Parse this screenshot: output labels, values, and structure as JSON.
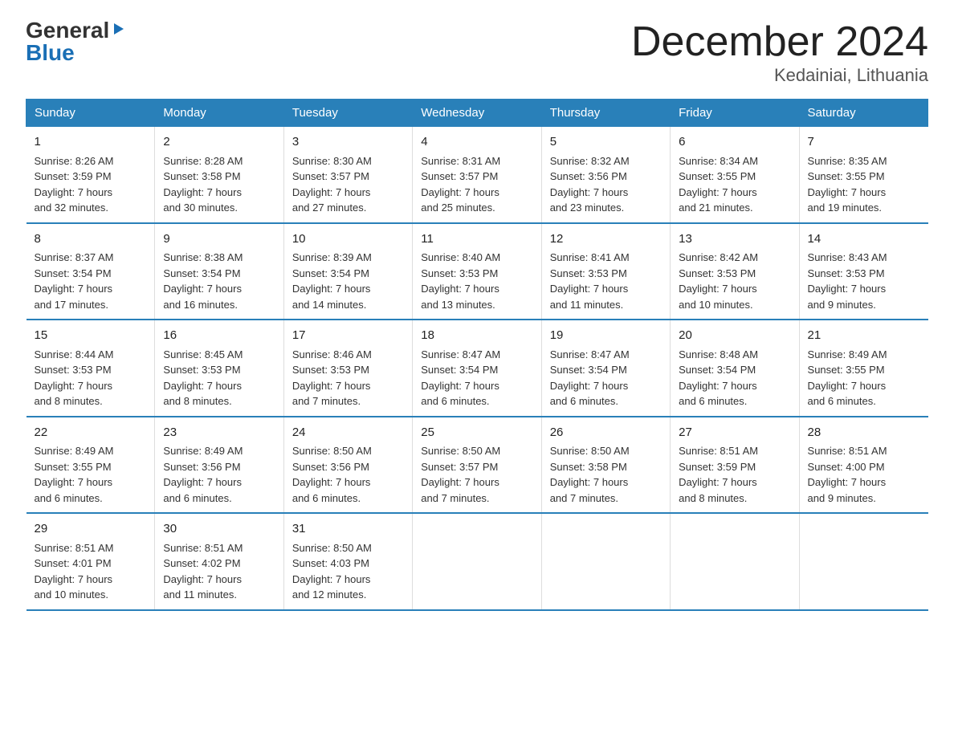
{
  "logo": {
    "general": "General",
    "blue": "Blue",
    "triangle": "▶"
  },
  "title": "December 2024",
  "subtitle": "Kedainiai, Lithuania",
  "weekdays": [
    "Sunday",
    "Monday",
    "Tuesday",
    "Wednesday",
    "Thursday",
    "Friday",
    "Saturday"
  ],
  "weeks": [
    [
      {
        "day": "1",
        "sunrise": "Sunrise: 8:26 AM",
        "sunset": "Sunset: 3:59 PM",
        "daylight": "Daylight: 7 hours",
        "minutes": "and 32 minutes."
      },
      {
        "day": "2",
        "sunrise": "Sunrise: 8:28 AM",
        "sunset": "Sunset: 3:58 PM",
        "daylight": "Daylight: 7 hours",
        "minutes": "and 30 minutes."
      },
      {
        "day": "3",
        "sunrise": "Sunrise: 8:30 AM",
        "sunset": "Sunset: 3:57 PM",
        "daylight": "Daylight: 7 hours",
        "minutes": "and 27 minutes."
      },
      {
        "day": "4",
        "sunrise": "Sunrise: 8:31 AM",
        "sunset": "Sunset: 3:57 PM",
        "daylight": "Daylight: 7 hours",
        "minutes": "and 25 minutes."
      },
      {
        "day": "5",
        "sunrise": "Sunrise: 8:32 AM",
        "sunset": "Sunset: 3:56 PM",
        "daylight": "Daylight: 7 hours",
        "minutes": "and 23 minutes."
      },
      {
        "day": "6",
        "sunrise": "Sunrise: 8:34 AM",
        "sunset": "Sunset: 3:55 PM",
        "daylight": "Daylight: 7 hours",
        "minutes": "and 21 minutes."
      },
      {
        "day": "7",
        "sunrise": "Sunrise: 8:35 AM",
        "sunset": "Sunset: 3:55 PM",
        "daylight": "Daylight: 7 hours",
        "minutes": "and 19 minutes."
      }
    ],
    [
      {
        "day": "8",
        "sunrise": "Sunrise: 8:37 AM",
        "sunset": "Sunset: 3:54 PM",
        "daylight": "Daylight: 7 hours",
        "minutes": "and 17 minutes."
      },
      {
        "day": "9",
        "sunrise": "Sunrise: 8:38 AM",
        "sunset": "Sunset: 3:54 PM",
        "daylight": "Daylight: 7 hours",
        "minutes": "and 16 minutes."
      },
      {
        "day": "10",
        "sunrise": "Sunrise: 8:39 AM",
        "sunset": "Sunset: 3:54 PM",
        "daylight": "Daylight: 7 hours",
        "minutes": "and 14 minutes."
      },
      {
        "day": "11",
        "sunrise": "Sunrise: 8:40 AM",
        "sunset": "Sunset: 3:53 PM",
        "daylight": "Daylight: 7 hours",
        "minutes": "and 13 minutes."
      },
      {
        "day": "12",
        "sunrise": "Sunrise: 8:41 AM",
        "sunset": "Sunset: 3:53 PM",
        "daylight": "Daylight: 7 hours",
        "minutes": "and 11 minutes."
      },
      {
        "day": "13",
        "sunrise": "Sunrise: 8:42 AM",
        "sunset": "Sunset: 3:53 PM",
        "daylight": "Daylight: 7 hours",
        "minutes": "and 10 minutes."
      },
      {
        "day": "14",
        "sunrise": "Sunrise: 8:43 AM",
        "sunset": "Sunset: 3:53 PM",
        "daylight": "Daylight: 7 hours",
        "minutes": "and 9 minutes."
      }
    ],
    [
      {
        "day": "15",
        "sunrise": "Sunrise: 8:44 AM",
        "sunset": "Sunset: 3:53 PM",
        "daylight": "Daylight: 7 hours",
        "minutes": "and 8 minutes."
      },
      {
        "day": "16",
        "sunrise": "Sunrise: 8:45 AM",
        "sunset": "Sunset: 3:53 PM",
        "daylight": "Daylight: 7 hours",
        "minutes": "and 8 minutes."
      },
      {
        "day": "17",
        "sunrise": "Sunrise: 8:46 AM",
        "sunset": "Sunset: 3:53 PM",
        "daylight": "Daylight: 7 hours",
        "minutes": "and 7 minutes."
      },
      {
        "day": "18",
        "sunrise": "Sunrise: 8:47 AM",
        "sunset": "Sunset: 3:54 PM",
        "daylight": "Daylight: 7 hours",
        "minutes": "and 6 minutes."
      },
      {
        "day": "19",
        "sunrise": "Sunrise: 8:47 AM",
        "sunset": "Sunset: 3:54 PM",
        "daylight": "Daylight: 7 hours",
        "minutes": "and 6 minutes."
      },
      {
        "day": "20",
        "sunrise": "Sunrise: 8:48 AM",
        "sunset": "Sunset: 3:54 PM",
        "daylight": "Daylight: 7 hours",
        "minutes": "and 6 minutes."
      },
      {
        "day": "21",
        "sunrise": "Sunrise: 8:49 AM",
        "sunset": "Sunset: 3:55 PM",
        "daylight": "Daylight: 7 hours",
        "minutes": "and 6 minutes."
      }
    ],
    [
      {
        "day": "22",
        "sunrise": "Sunrise: 8:49 AM",
        "sunset": "Sunset: 3:55 PM",
        "daylight": "Daylight: 7 hours",
        "minutes": "and 6 minutes."
      },
      {
        "day": "23",
        "sunrise": "Sunrise: 8:49 AM",
        "sunset": "Sunset: 3:56 PM",
        "daylight": "Daylight: 7 hours",
        "minutes": "and 6 minutes."
      },
      {
        "day": "24",
        "sunrise": "Sunrise: 8:50 AM",
        "sunset": "Sunset: 3:56 PM",
        "daylight": "Daylight: 7 hours",
        "minutes": "and 6 minutes."
      },
      {
        "day": "25",
        "sunrise": "Sunrise: 8:50 AM",
        "sunset": "Sunset: 3:57 PM",
        "daylight": "Daylight: 7 hours",
        "minutes": "and 7 minutes."
      },
      {
        "day": "26",
        "sunrise": "Sunrise: 8:50 AM",
        "sunset": "Sunset: 3:58 PM",
        "daylight": "Daylight: 7 hours",
        "minutes": "and 7 minutes."
      },
      {
        "day": "27",
        "sunrise": "Sunrise: 8:51 AM",
        "sunset": "Sunset: 3:59 PM",
        "daylight": "Daylight: 7 hours",
        "minutes": "and 8 minutes."
      },
      {
        "day": "28",
        "sunrise": "Sunrise: 8:51 AM",
        "sunset": "Sunset: 4:00 PM",
        "daylight": "Daylight: 7 hours",
        "minutes": "and 9 minutes."
      }
    ],
    [
      {
        "day": "29",
        "sunrise": "Sunrise: 8:51 AM",
        "sunset": "Sunset: 4:01 PM",
        "daylight": "Daylight: 7 hours",
        "minutes": "and 10 minutes."
      },
      {
        "day": "30",
        "sunrise": "Sunrise: 8:51 AM",
        "sunset": "Sunset: 4:02 PM",
        "daylight": "Daylight: 7 hours",
        "minutes": "and 11 minutes."
      },
      {
        "day": "31",
        "sunrise": "Sunrise: 8:50 AM",
        "sunset": "Sunset: 4:03 PM",
        "daylight": "Daylight: 7 hours",
        "minutes": "and 12 minutes."
      },
      null,
      null,
      null,
      null
    ]
  ]
}
